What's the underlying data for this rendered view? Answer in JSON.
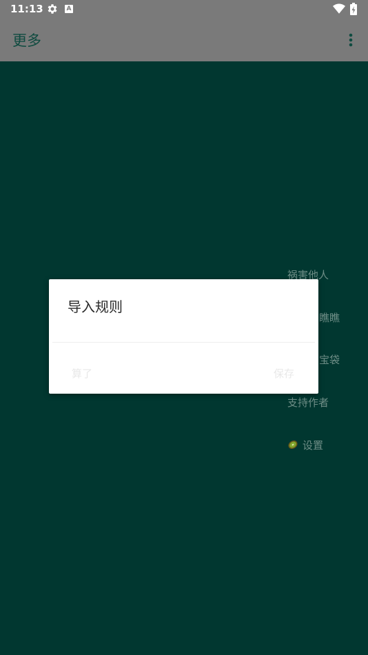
{
  "status_bar": {
    "time": "11:13",
    "icons": [
      "settings-gear-icon",
      "a-notification-icon",
      "wifi-icon",
      "battery-charging-icon"
    ],
    "a_icon_letter": "A"
  },
  "app_bar": {
    "title": "更多",
    "overflow_icon": "more-vert-icon"
  },
  "menu": {
    "items": [
      {
        "label": "祸害他人"
      },
      {
        "label": "瞧瞧"
      },
      {
        "label": "宝袋"
      },
      {
        "label": "支持作者"
      },
      {
        "label": "设置",
        "icon": "kiwi-icon"
      }
    ]
  },
  "dialog": {
    "title": "导入规则",
    "cancel_label": "算了",
    "save_label": "保存"
  },
  "colors": {
    "background": "#013730",
    "app_bar": "#7a7a7a",
    "title_text": "#0f4b40",
    "dialog": "#ffffff"
  }
}
